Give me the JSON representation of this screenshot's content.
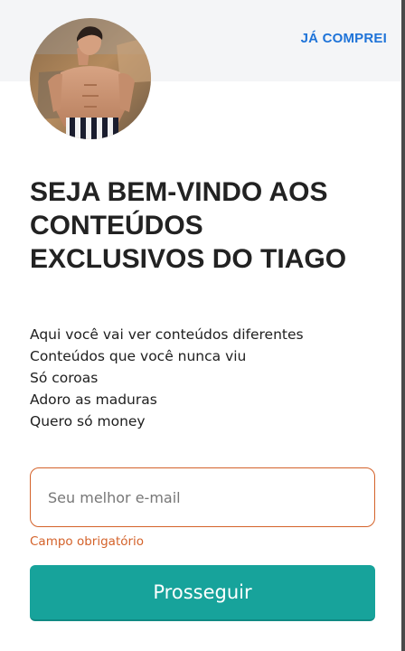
{
  "header": {
    "link_label": "JÁ COMPREI"
  },
  "hero": {
    "title": "SEJA BEM-VINDO AOS CONTEÚDOS EXCLUSIVOS DO TIAGO",
    "lines": [
      "Aqui você vai ver conteúdos diferentes",
      "Conteúdos que você nunca viu",
      "Só coroas",
      "Adoro as maduras",
      "Quero só money"
    ]
  },
  "form": {
    "email_placeholder": "Seu melhor e-mail",
    "email_value": "",
    "error": "Campo obrigatório",
    "submit_label": "Prosseguir"
  },
  "colors": {
    "link": "#1e73d8",
    "error": "#d4622a",
    "button": "#17a39b"
  }
}
